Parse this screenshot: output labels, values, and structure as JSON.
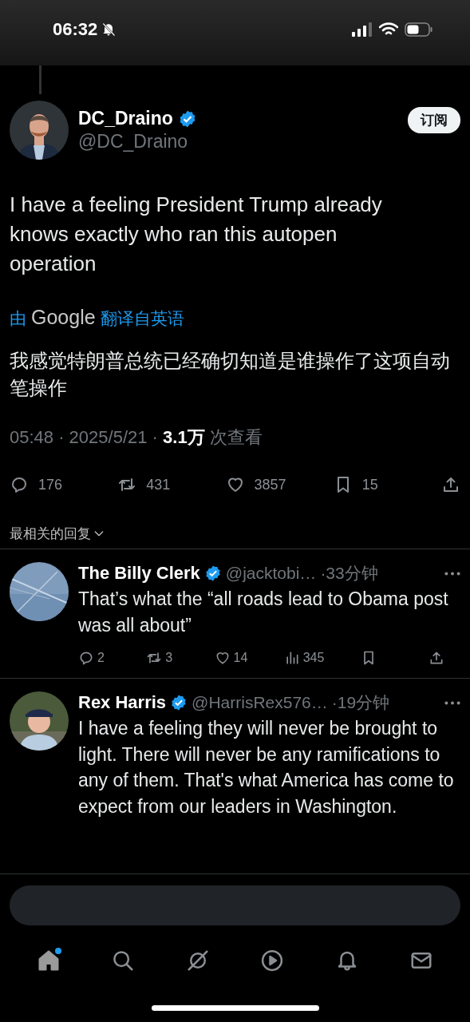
{
  "status_bar": {
    "time": "06:32",
    "silent": true
  },
  "tweet": {
    "name": "DC_Draino",
    "verified": true,
    "handle": "@DC_Draino",
    "subscribe_label": "订阅",
    "text": "I have a feeling President Trump already knows exactly who ran this autopen operation",
    "translation": {
      "prefix": "由",
      "provider": "Google",
      "suffix": "翻译自英语",
      "text": "我感觉特朗普总统已经确切知道是谁操作了这项自动笔操作"
    },
    "meta": "05:48 · 2025/5/21 · **3.1万** 次查看",
    "actions": [
      {
        "kind": "reply",
        "count": "176"
      },
      {
        "kind": "retweet",
        "count": "431"
      },
      {
        "kind": "like",
        "count": "3857"
      },
      {
        "kind": "bookmark",
        "count": "15"
      },
      {
        "kind": "share"
      }
    ]
  },
  "replies_sort": {
    "label": "最相关的回复"
  },
  "replies": [
    {
      "name": "The Billy Clerk",
      "verified": true,
      "handle": "@jacktobi…",
      "time": "·33分钟",
      "text": "That’s what the “all roads lead to Obama post was all about”",
      "actions": [
        {
          "kind": "reply",
          "count": "2"
        },
        {
          "kind": "retweet",
          "count": "3"
        },
        {
          "kind": "like",
          "count": "14"
        },
        {
          "kind": "views",
          "count": "345"
        },
        {
          "kind": "bookmark"
        },
        {
          "kind": "share"
        }
      ]
    },
    {
      "name": "Rex Harris",
      "verified": true,
      "handle": "@HarrisRex576…",
      "time": "·19分钟",
      "text": "I have a feeling they will never be brought to light. There will never be any ramifications to any of them.  That's what America has come to expect from our leaders in Washington."
    }
  ],
  "nav": [
    {
      "kind": "home",
      "selected": true,
      "badge": true
    },
    {
      "kind": "search",
      "selected": false,
      "badge": false
    },
    {
      "kind": "grok",
      "selected": false,
      "badge": false
    },
    {
      "kind": "video",
      "selected": false,
      "badge": false
    },
    {
      "kind": "notifications",
      "selected": false,
      "badge": false
    },
    {
      "kind": "messages",
      "selected": false,
      "badge": false
    }
  ]
}
